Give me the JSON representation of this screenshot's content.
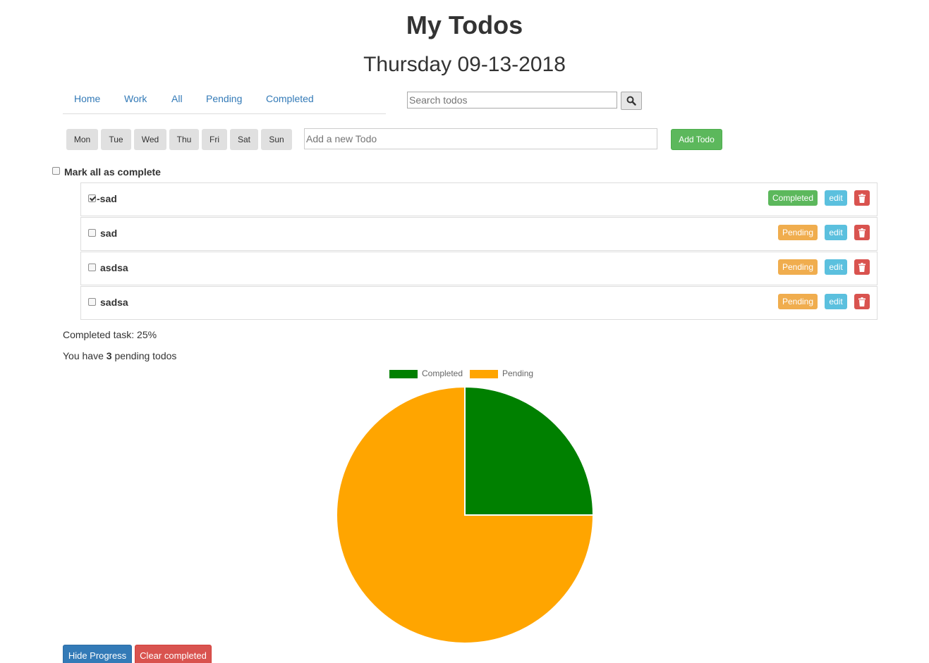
{
  "header": {
    "title": "My Todos",
    "date": "Thursday 09-13-2018"
  },
  "nav": {
    "items": [
      "Home",
      "Work",
      "All",
      "Pending",
      "Completed"
    ]
  },
  "search": {
    "placeholder": "Search todos",
    "icon": "search-icon"
  },
  "days": [
    "Mon",
    "Tue",
    "Wed",
    "Thu",
    "Fri",
    "Sat",
    "Sun"
  ],
  "new_todo": {
    "placeholder": "Add a new Todo",
    "add_label": "Add Todo"
  },
  "mark_all": {
    "label": "Mark all as complete",
    "checked": false
  },
  "todos": [
    {
      "text": "-sad",
      "checked": true,
      "status": "Completed",
      "edit_label": "edit"
    },
    {
      "text": "sad",
      "checked": false,
      "status": "Pending",
      "edit_label": "edit"
    },
    {
      "text": "asdsa",
      "checked": false,
      "status": "Pending",
      "edit_label": "edit"
    },
    {
      "text": "sadsa",
      "checked": false,
      "status": "Pending",
      "edit_label": "edit"
    }
  ],
  "stats": {
    "completed_text": "Completed task: 25%",
    "pending_prefix": "You have",
    "pending_count": "3",
    "pending_suffix": "pending todos"
  },
  "colors": {
    "completed": "#008000",
    "pending": "#FFA500",
    "badge_completed": "#5cb85c",
    "badge_pending": "#f0ad4e",
    "edit": "#5bc0de",
    "delete": "#d9534f",
    "primary": "#337ab7"
  },
  "chart_data": {
    "type": "pie",
    "categories": [
      "Completed",
      "Pending"
    ],
    "values": [
      1,
      3
    ],
    "legend": "top-center",
    "colors": [
      "#008000",
      "#FFA500"
    ]
  },
  "buttons": {
    "hide_progress": "Hide Progress",
    "clear_completed": "Clear completed"
  }
}
